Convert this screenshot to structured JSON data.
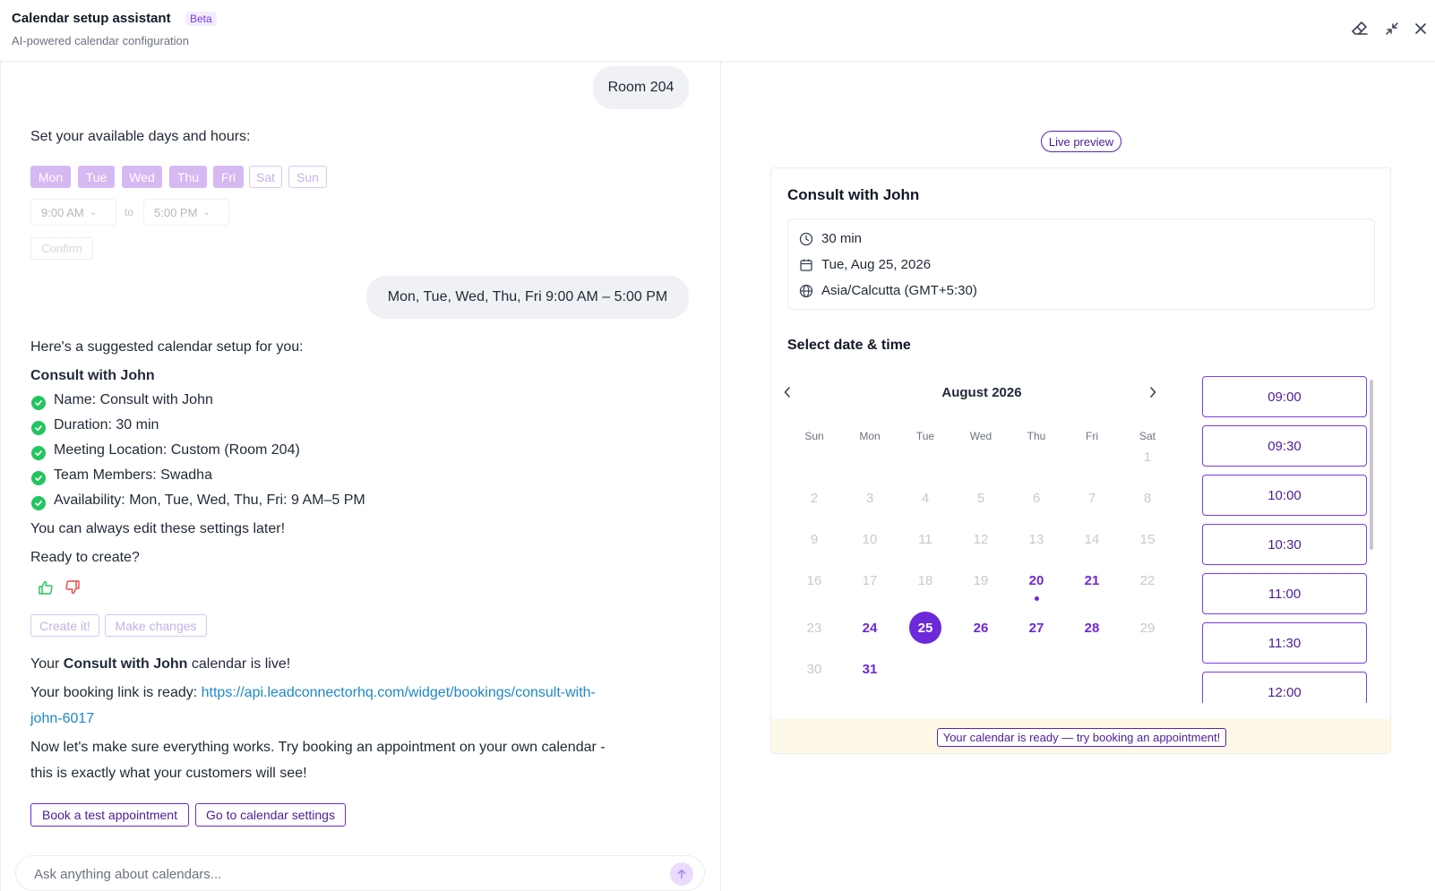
{
  "header": {
    "title": "Calendar setup assistant",
    "beta": "Beta",
    "subtitle": "AI-powered calendar configuration",
    "icons": [
      "eraser-icon",
      "minimize-icon",
      "close-icon"
    ]
  },
  "chat": {
    "msg_room": "Room 204",
    "prompt_days": "Set your available days and hours:",
    "days": [
      {
        "label": "Mon",
        "selected": true
      },
      {
        "label": "Tue",
        "selected": true
      },
      {
        "label": "Wed",
        "selected": true
      },
      {
        "label": "Thu",
        "selected": true
      },
      {
        "label": "Fri",
        "selected": true
      },
      {
        "label": "Sat",
        "selected": false
      },
      {
        "label": "Sun",
        "selected": false
      }
    ],
    "start_time": "9:00 AM",
    "to_label": "to",
    "end_time": "5:00 PM",
    "confirm_label": "Confirm",
    "msg_schedule": "Mon, Tue, Wed, Thu, Fri 9:00 AM – 5:00 PM",
    "suggest_intro": "Here's a suggested calendar setup for you:",
    "suggest_title": "Consult with John",
    "checklist": [
      "Name: Consult with John",
      "Duration: 30 min",
      "Meeting Location: Custom (Room 204)",
      "Team Members: Swadha",
      "Availability: Mon, Tue, Wed, Thu, Fri: 9 AM–5 PM"
    ],
    "edit_note": "You can always edit these settings later!",
    "ready_q": "Ready to create?",
    "create_label": "Create it!",
    "changes_label": "Make changes",
    "live_pre": "Your ",
    "live_bold": "Consult with John",
    "live_post": " calendar is live!",
    "booking_pre": "Your booking link is ready: ",
    "booking_link_1": "https://api.leadconnectorhq.com/widget/bookings/consult-with-",
    "booking_link_2": "john-6017",
    "test_line_1": "Now let's make sure everything works. Try booking an appointment on your own calendar -",
    "test_line_2": "this is exactly what your customers will see!",
    "book_test_label": "Book a test appointment",
    "settings_label": "Go to calendar settings",
    "input_placeholder": "Ask anything about calendars..."
  },
  "preview": {
    "badge": "Live preview",
    "title": "Consult with John",
    "duration": "30 min",
    "date": "Tue, Aug 25, 2026",
    "timezone": "Asia/Calcutta (GMT+5:30)",
    "select_title": "Select date & time",
    "month": "August 2026",
    "weekdays": [
      "Sun",
      "Mon",
      "Tue",
      "Wed",
      "Thu",
      "Fri",
      "Sat"
    ],
    "selected_day": 25,
    "today_day": 20,
    "available_days": [
      20,
      21,
      24,
      25,
      26,
      27,
      28,
      31
    ],
    "slots": [
      "09:00",
      "09:30",
      "10:00",
      "10:30",
      "11:00",
      "11:30",
      "12:00"
    ],
    "banner": "Your calendar is ready — try booking an appointment!"
  },
  "colors": {
    "accent": "#6d28d9",
    "success": "#22c55e",
    "link": "#1e88c7",
    "banner_bg": "#fdf9e6"
  }
}
